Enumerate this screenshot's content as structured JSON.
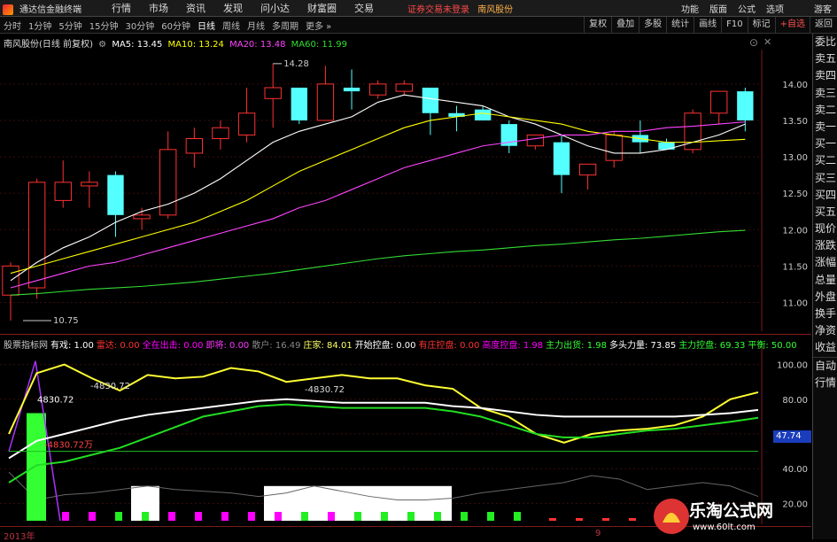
{
  "titlebar": {
    "app_name": "通达信金融终端",
    "menu": [
      "行情",
      "市场",
      "资讯",
      "发现",
      "问小达",
      "财富圈",
      "交易"
    ],
    "alert": "证券交易未登录",
    "stock_name": "南风股份",
    "right_menu": [
      "功能",
      "版面",
      "公式",
      "选项"
    ],
    "guest": "游客"
  },
  "periods": [
    "分时",
    "1分钟",
    "5分钟",
    "15分钟",
    "30分钟",
    "60分钟",
    "日线",
    "周线",
    "月线",
    "多周期",
    "更多"
  ],
  "active_period": "日线",
  "toolbar": [
    "复权",
    "叠加",
    "多股",
    "统计",
    "画线",
    "F10",
    "标记",
    "+自选",
    "返回"
  ],
  "sidebar": [
    "委比",
    "卖五",
    "卖四",
    "卖三",
    "卖二",
    "卖一",
    "买一",
    "买二",
    "买三",
    "买四",
    "买五",
    "现价",
    "涨跌",
    "涨幅",
    "总量",
    "外盘",
    "换手",
    "净资",
    "收益"
  ],
  "sidebar2": [
    "自动",
    "行情"
  ],
  "main_legend": {
    "title": "南风股份(日线 前复权)",
    "ma5": "MA5: 13.45",
    "ma10": "MA10: 13.24",
    "ma20": "MA20: 13.48",
    "ma60": "MA60: 11.99"
  },
  "sub_legend": [
    {
      "t": "股票指标网",
      "c": "#c8c8c8"
    },
    {
      "t": "有戏: 1.00",
      "c": "#ffffff"
    },
    {
      "t": "雷达: 0.00",
      "c": "#ff3333"
    },
    {
      "t": "全在出击: 0.00",
      "c": "#ff00ff"
    },
    {
      "t": "即将: 0.00",
      "c": "#ff33ff"
    },
    {
      "t": "散户: 16.49",
      "c": "#888888"
    },
    {
      "t": "庄家: 84.01",
      "c": "#ffff66"
    },
    {
      "t": "开始控盘: 0.00",
      "c": "#ffffff"
    },
    {
      "t": "有庄控盘: 0.00",
      "c": "#ff3333"
    },
    {
      "t": "高度控盘: 1.98",
      "c": "#ff00ff"
    },
    {
      "t": "主力出货: 1.98",
      "c": "#33ff33"
    },
    {
      "t": "多头力量: 73.85",
      "c": "#ffffff"
    },
    {
      "t": "主力控盘: 69.33",
      "c": "#33ff33"
    },
    {
      "t": "平衡: 50.00",
      "c": "#33ff33"
    }
  ],
  "colors": {
    "up": "#ff3232",
    "down": "#54ffff",
    "ma5": "#ffffff",
    "ma10": "#ffff00",
    "ma20": "#ff44ff",
    "ma60": "#33dd33"
  },
  "chart_data": [
    {
      "type": "candlestick",
      "title": "南风股份(日线 前复权)",
      "ylim": [
        10.75,
        14.4
      ],
      "yticks": [
        11.0,
        11.5,
        12.0,
        12.5,
        13.0,
        13.5,
        14.0
      ],
      "annotations": {
        "high": "14.28",
        "low": "10.75"
      },
      "candles": [
        {
          "o": 11.1,
          "h": 11.55,
          "l": 10.75,
          "c": 11.5
        },
        {
          "o": 11.2,
          "h": 12.7,
          "l": 11.05,
          "c": 12.65
        },
        {
          "o": 12.4,
          "h": 12.95,
          "l": 12.3,
          "c": 12.65
        },
        {
          "o": 12.6,
          "h": 12.8,
          "l": 12.3,
          "c": 12.65
        },
        {
          "o": 12.75,
          "h": 12.8,
          "l": 11.9,
          "c": 12.2
        },
        {
          "o": 12.15,
          "h": 12.3,
          "l": 12.0,
          "c": 12.2
        },
        {
          "o": 12.2,
          "h": 13.35,
          "l": 12.15,
          "c": 13.1
        },
        {
          "o": 13.05,
          "h": 13.4,
          "l": 12.85,
          "c": 13.25
        },
        {
          "o": 13.25,
          "h": 13.5,
          "l": 13.1,
          "c": 13.4
        },
        {
          "o": 13.3,
          "h": 13.95,
          "l": 13.2,
          "c": 13.6
        },
        {
          "o": 13.8,
          "h": 14.28,
          "l": 13.4,
          "c": 13.95
        },
        {
          "o": 13.95,
          "h": 13.95,
          "l": 13.45,
          "c": 13.5
        },
        {
          "o": 13.5,
          "h": 14.25,
          "l": 13.5,
          "c": 14.0
        },
        {
          "o": 13.95,
          "h": 14.2,
          "l": 13.65,
          "c": 13.9
        },
        {
          "o": 13.85,
          "h": 14.05,
          "l": 13.8,
          "c": 14.0
        },
        {
          "o": 13.9,
          "h": 14.05,
          "l": 13.85,
          "c": 14.0
        },
        {
          "o": 13.95,
          "h": 13.95,
          "l": 13.3,
          "c": 13.6
        },
        {
          "o": 13.6,
          "h": 13.7,
          "l": 13.35,
          "c": 13.55
        },
        {
          "o": 13.65,
          "h": 13.7,
          "l": 13.5,
          "c": 13.5
        },
        {
          "o": 13.45,
          "h": 13.5,
          "l": 13.05,
          "c": 13.15
        },
        {
          "o": 13.15,
          "h": 13.3,
          "l": 13.1,
          "c": 13.3
        },
        {
          "o": 13.2,
          "h": 13.3,
          "l": 12.5,
          "c": 12.75
        },
        {
          "o": 12.75,
          "h": 12.9,
          "l": 12.55,
          "c": 12.9
        },
        {
          "o": 12.95,
          "h": 13.35,
          "l": 12.85,
          "c": 13.3
        },
        {
          "o": 13.3,
          "h": 13.5,
          "l": 13.05,
          "c": 13.2
        },
        {
          "o": 13.2,
          "h": 13.25,
          "l": 13.1,
          "c": 13.1
        },
        {
          "o": 13.1,
          "h": 13.65,
          "l": 13.05,
          "c": 13.6
        },
        {
          "o": 13.6,
          "h": 13.9,
          "l": 13.45,
          "c": 13.9
        },
        {
          "o": 13.9,
          "h": 13.95,
          "l": 13.35,
          "c": 13.5
        }
      ],
      "series": [
        {
          "name": "MA5",
          "values": [
            11.3,
            11.55,
            11.75,
            11.9,
            12.1,
            12.25,
            12.35,
            12.5,
            12.7,
            12.95,
            13.2,
            13.35,
            13.45,
            13.55,
            13.75,
            13.85,
            13.8,
            13.75,
            13.7,
            13.55,
            13.45,
            13.3,
            13.15,
            13.05,
            13.05,
            13.1,
            13.2,
            13.3,
            13.45
          ]
        },
        {
          "name": "MA10",
          "values": [
            11.4,
            11.5,
            11.6,
            11.7,
            11.8,
            11.9,
            12.0,
            12.1,
            12.25,
            12.4,
            12.6,
            12.8,
            12.95,
            13.1,
            13.25,
            13.4,
            13.5,
            13.55,
            13.6,
            13.55,
            13.5,
            13.45,
            13.35,
            13.3,
            13.25,
            13.2,
            13.2,
            13.22,
            13.24
          ]
        },
        {
          "name": "MA20",
          "values": [
            11.2,
            11.3,
            11.4,
            11.5,
            11.55,
            11.65,
            11.75,
            11.85,
            11.95,
            12.05,
            12.15,
            12.3,
            12.4,
            12.55,
            12.7,
            12.85,
            12.95,
            13.05,
            13.15,
            13.2,
            13.25,
            13.3,
            13.3,
            13.35,
            13.35,
            13.4,
            13.42,
            13.45,
            13.48
          ]
        },
        {
          "name": "MA60",
          "values": [
            11.1,
            11.12,
            11.15,
            11.18,
            11.2,
            11.22,
            11.25,
            11.28,
            11.32,
            11.36,
            11.4,
            11.45,
            11.5,
            11.55,
            11.6,
            11.64,
            11.67,
            11.7,
            11.72,
            11.75,
            11.78,
            11.8,
            11.83,
            11.86,
            11.88,
            11.91,
            11.94,
            11.97,
            11.99
          ]
        }
      ]
    },
    {
      "type": "line",
      "title": "股票指标网",
      "ylim": [
        10,
        110
      ],
      "yticks": [
        20,
        40,
        60,
        80,
        100
      ],
      "annotations": [
        "4830.72",
        "-4830.72",
        "-4830.72",
        "-4830.72万"
      ],
      "badge": "47.74",
      "series": [
        {
          "name": "庄家",
          "values": [
            60,
            95,
            100,
            92,
            85,
            94,
            92,
            93,
            98,
            96,
            90,
            92,
            94,
            92,
            92,
            88,
            86,
            75,
            70,
            60,
            55,
            60,
            62,
            63,
            65,
            70,
            80,
            84
          ]
        },
        {
          "name": "多头力量",
          "values": [
            46,
            56,
            60,
            64,
            68,
            71,
            73,
            75,
            77,
            79,
            80,
            79,
            78,
            78,
            78,
            78,
            76,
            75,
            73,
            71,
            70,
            70,
            70,
            70,
            70,
            71,
            72,
            73.85
          ]
        },
        {
          "name": "主力控盘",
          "values": [
            32,
            42,
            44,
            48,
            52,
            58,
            64,
            70,
            73,
            76,
            77,
            76,
            75,
            75,
            75,
            75,
            73,
            70,
            65,
            60,
            58,
            58,
            60,
            62,
            63,
            65,
            67,
            69.33
          ]
        },
        {
          "name": "平衡",
          "values": [
            50,
            50,
            50,
            50,
            50,
            50,
            50,
            50,
            50,
            50,
            50,
            50,
            50,
            50,
            50,
            50,
            50,
            50,
            50,
            50,
            50,
            50,
            50,
            50,
            50,
            50,
            50,
            50
          ]
        }
      ]
    }
  ],
  "dates": [
    "2013年",
    "9"
  ],
  "watermark": {
    "cn": "乐淘公式网",
    "url": "www.60lt.com"
  }
}
